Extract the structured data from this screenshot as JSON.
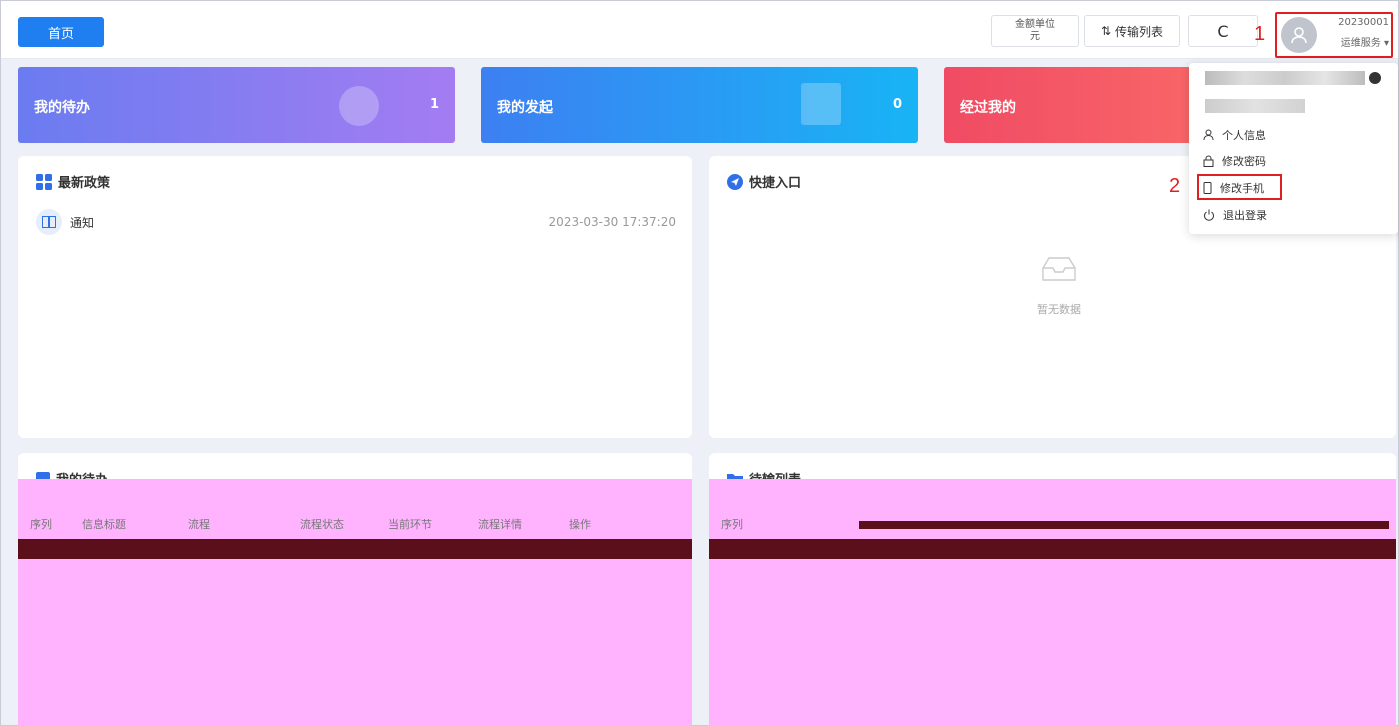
{
  "topbar": {
    "home_label": "首页",
    "unit_line1": "金额单位",
    "unit_line2": "元",
    "transfer_label": "传输列表",
    "refresh_glyph": "C",
    "user_id": "20230001",
    "user_role": "运维服务 ▾",
    "marker_1": "1",
    "marker_2": "2"
  },
  "cards": [
    {
      "label": "我的待办",
      "count": "1"
    },
    {
      "label": "我的发起",
      "count": "0"
    },
    {
      "label": "经过我的"
    }
  ],
  "policy": {
    "title": "最新政策",
    "item_text": "通知",
    "item_date": "2023-03-30 17:37:20"
  },
  "quick": {
    "title": "快捷入口",
    "empty_text": "暂无数据"
  },
  "todo": {
    "title": "我的待办",
    "headers": [
      "序列",
      "信息标题",
      "流程",
      "流程状态",
      "当前环节",
      "流程详情",
      "操作"
    ]
  },
  "trans": {
    "title": "待输列表",
    "headers": [
      "序列"
    ]
  },
  "dropdown": {
    "items": [
      "个人信息",
      "修改密码",
      "修改手机",
      "退出登录"
    ]
  },
  "colors": {
    "primary": "#1f7ff0",
    "highlight": "#e02020"
  }
}
